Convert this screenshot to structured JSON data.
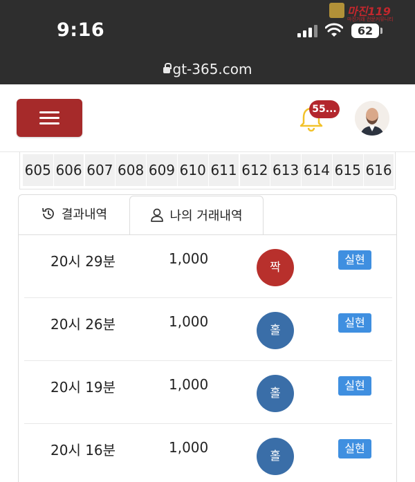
{
  "status_bar": {
    "time": "9:16",
    "battery": "62",
    "url": "gt-365.com",
    "watermark_title": "마진",
    "watermark_number": "119",
    "watermark_sub": "마진거래 전문커뮤니티"
  },
  "header": {
    "notification_count": "55...",
    "accent_color": "#a62a2a"
  },
  "number_strip": [
    "605",
    "606",
    "607",
    "608",
    "609",
    "610",
    "611",
    "612",
    "613",
    "614",
    "615",
    "616"
  ],
  "tabs": [
    {
      "label": "결과내역",
      "icon": "history-icon",
      "active": false
    },
    {
      "label": "나의 거래내역",
      "icon": "user-icon",
      "active": true
    }
  ],
  "rows": [
    {
      "time": "20시 29분",
      "amount": "1,000",
      "pick": "짝",
      "pick_color": "#b8302c",
      "status": "실현"
    },
    {
      "time": "20시 26분",
      "amount": "1,000",
      "pick": "홀",
      "pick_color": "#3a6ea8",
      "status": "실현"
    },
    {
      "time": "20시 19분",
      "amount": "1,000",
      "pick": "홀",
      "pick_color": "#3a6ea8",
      "status": "실현"
    },
    {
      "time": "20시 16분",
      "amount": "1,000",
      "pick": "홀",
      "pick_color": "#3a6ea8",
      "status": "실현"
    }
  ]
}
